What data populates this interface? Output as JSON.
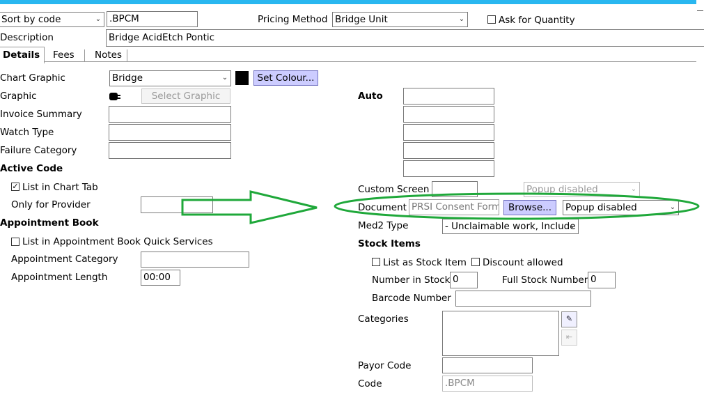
{
  "colors": {
    "accent_bar": "#29b7f0",
    "button_purple": "#ccccff",
    "annotation_green": "#1fa83a"
  },
  "top": {
    "sort_select": "Sort by code",
    "code_value": ".BPCM",
    "pricing_label": "Pricing Method",
    "pricing_select": "Bridge Unit",
    "ask_qty_label": "Ask for Quantity",
    "description_label": "Description",
    "description_value": "Bridge AcidEtch Pontic"
  },
  "tabs": [
    "Details",
    "Fees",
    "Notes"
  ],
  "left": {
    "chart_graphic_label": "Chart Graphic",
    "chart_graphic_select": "Bridge",
    "set_colour": "Set Colour...",
    "graphic_label": "Graphic",
    "select_graphic": "Select Graphic",
    "invoice_summary_label": "Invoice Summary",
    "watch_type_label": "Watch Type",
    "failure_category_label": "Failure Category",
    "active_code_heading": "Active Code",
    "list_in_chart_tab": "List in Chart Tab",
    "only_for_provider": "Only for Provider",
    "appointment_book_heading": "Appointment Book",
    "list_in_appt_quick": "List in Appointment Book Quick Services",
    "appt_category_label": "Appointment Category",
    "appt_length_label": "Appointment Length",
    "appt_length_value": "00:00"
  },
  "right": {
    "auto_label": "Auto",
    "custom_screen_label": "Custom Screen",
    "custom_popup_select": "Popup disabled",
    "document_label": "Document",
    "document_value": "PRSI Consent Form",
    "browse": "Browse...",
    "document_popup_select": "Popup disabled",
    "med2_label": "Med2 Type",
    "med2_select": "-  Unclaimable work, Include",
    "stock_items_heading": "Stock Items",
    "list_as_stock_item": "List as Stock Item",
    "discount_allowed": "Discount allowed",
    "number_in_stock_label": "Number in Stock",
    "number_in_stock_value": "0",
    "full_stock_label": "Full Stock Number",
    "full_stock_value": "0",
    "barcode_label": "Barcode Number",
    "categories_label": "Categories",
    "payor_code_label": "Payor Code",
    "code_label": "Code",
    "code_value": ".BPCM"
  },
  "icons": {
    "graphic_icon": "bridge-graphic-icon",
    "categories_edit": "edit-list-icon",
    "categories_remove": "remove-list-icon"
  },
  "checked": {
    "ask_for_quantity": false,
    "list_in_chart_tab": true,
    "list_in_appt_quick": false,
    "list_as_stock_item": false,
    "discount_allowed": false
  }
}
